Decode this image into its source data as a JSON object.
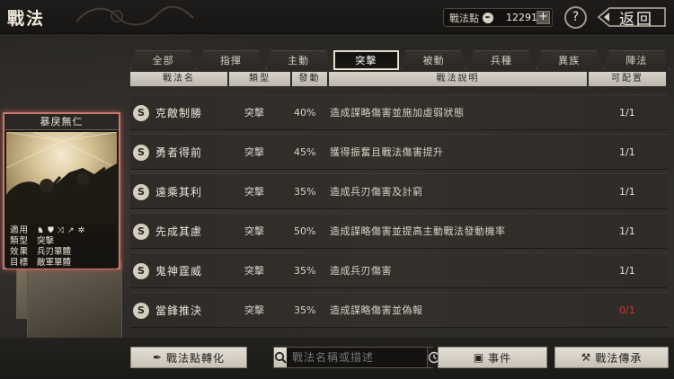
{
  "header": {
    "title": "戰法",
    "points_label": "戰法點",
    "points_value": "12291",
    "plus_label": "+",
    "help_label": "?",
    "back_label": "返回"
  },
  "tabs": [
    {
      "label": "全部",
      "active": false
    },
    {
      "label": "指揮",
      "active": false
    },
    {
      "label": "主動",
      "active": false
    },
    {
      "label": "突擊",
      "active": true
    },
    {
      "label": "被動",
      "active": false
    },
    {
      "label": "兵種",
      "active": false
    },
    {
      "label": "異族",
      "active": false
    },
    {
      "label": "陣法",
      "active": false
    }
  ],
  "columns": [
    "戰法名",
    "類型",
    "發動",
    "戰法說明",
    "可配置"
  ],
  "rows": [
    {
      "badge": "S",
      "name": "克敵制勝",
      "type": "突擊",
      "trigger": "40%",
      "desc": "造成謀略傷害並施加虛弱狀態",
      "avail": "1/1",
      "avail_color": "#e8e2d6"
    },
    {
      "badge": "S",
      "name": "勇者得前",
      "type": "突擊",
      "trigger": "45%",
      "desc": "獲得振奮且戰法傷害提升",
      "avail": "1/1",
      "avail_color": "#e8e2d6"
    },
    {
      "badge": "S",
      "name": "遠乘其利",
      "type": "突擊",
      "trigger": "35%",
      "desc": "造成兵刃傷害及計窮",
      "avail": "1/1",
      "avail_color": "#e8e2d6"
    },
    {
      "badge": "S",
      "name": "先成其慮",
      "type": "突擊",
      "trigger": "50%",
      "desc": "造成謀略傷害並提高主動戰法發動機率",
      "avail": "1/1",
      "avail_color": "#e8e2d6"
    },
    {
      "badge": "S",
      "name": "鬼神霆威",
      "type": "突擊",
      "trigger": "35%",
      "desc": "造成兵刃傷害",
      "avail": "1/1",
      "avail_color": "#e8e2d6"
    },
    {
      "badge": "S",
      "name": "當鋒推決",
      "type": "突擊",
      "trigger": "35%",
      "desc": "造成謀略傷害並偽報",
      "avail": "0/1",
      "avail_color": "#c23a2e"
    }
  ],
  "card": {
    "title": "暴戾無仁",
    "use_label": "適用",
    "type_label": "類型",
    "type_value": "突擊",
    "effect_label": "效果",
    "effect_value": "兵刃單體",
    "target_label": "目標",
    "target_value": "敵軍單體",
    "use_icons": [
      "horse-icon",
      "shield-icon",
      "bow-icon",
      "spear-icon",
      "wheel-icon"
    ]
  },
  "footer": {
    "convert_label": "戰法點轉化",
    "search_placeholder": "戰法名稱或描述",
    "event_label": "事件",
    "inherit_label": "戰法傳承"
  }
}
